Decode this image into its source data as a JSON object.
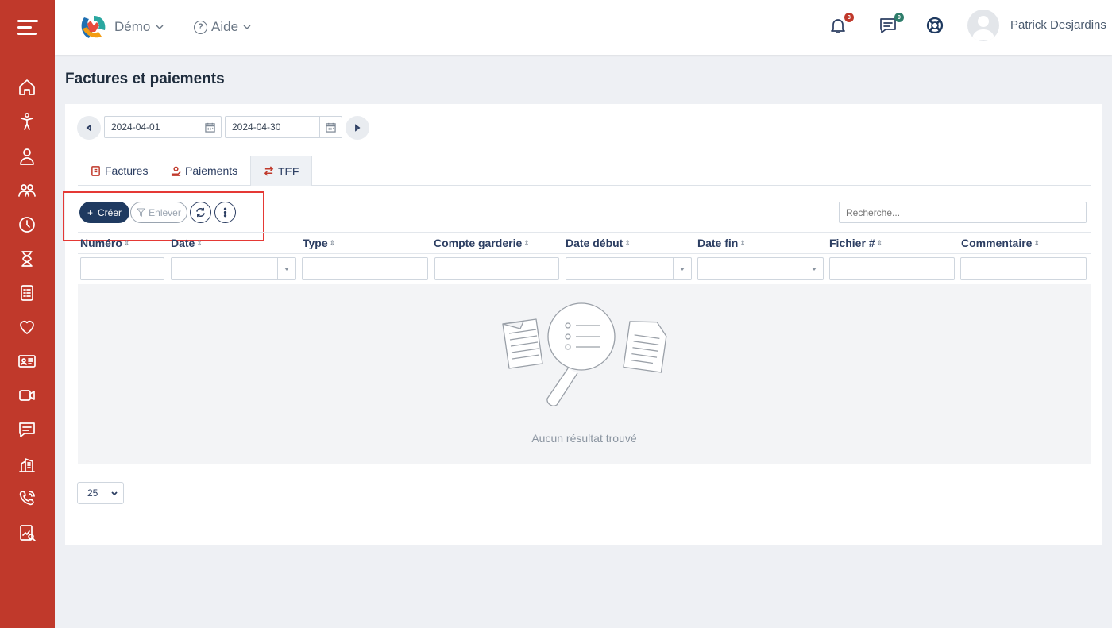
{
  "header": {
    "org_name": "Démo",
    "help_label": "Aide",
    "notifications_count": "3",
    "messages_count": "9",
    "user_name": "Patrick Desjardins"
  },
  "sidebar": {
    "items": [
      {
        "icon": "home-icon"
      },
      {
        "icon": "child-icon"
      },
      {
        "icon": "staff-icon"
      },
      {
        "icon": "parents-icon"
      },
      {
        "icon": "clock-icon"
      },
      {
        "icon": "hourglass-icon"
      },
      {
        "icon": "invoice-icon"
      },
      {
        "icon": "heart-icon"
      },
      {
        "icon": "id-card-icon"
      },
      {
        "icon": "video-icon"
      },
      {
        "icon": "chat-icon"
      },
      {
        "icon": "building-icon"
      },
      {
        "icon": "phone-icon"
      },
      {
        "icon": "report-icon"
      }
    ]
  },
  "page": {
    "title": "Factures et paiements",
    "date_from": "2024-04-01",
    "date_to": "2024-04-30",
    "tabs": [
      {
        "label": "Factures",
        "active": false
      },
      {
        "label": "Paiements",
        "active": false
      },
      {
        "label": "TEF",
        "active": true
      }
    ],
    "toolbar": {
      "create_label": "Créer",
      "remove_label": "Enlever",
      "search_placeholder": "Recherche..."
    },
    "columns": [
      "Numéro",
      "Date",
      "Type",
      "Compte garderie",
      "Date début",
      "Date fin",
      "Fichier #",
      "Commentaire"
    ],
    "empty_message": "Aucun résultat trouvé",
    "page_size": "25"
  },
  "colors": {
    "sidebar": "#c0392b",
    "primary": "#1f3a60",
    "highlight_box": "#e53935",
    "notification_badge": "#c0392b",
    "message_badge": "#2e7d6b"
  }
}
